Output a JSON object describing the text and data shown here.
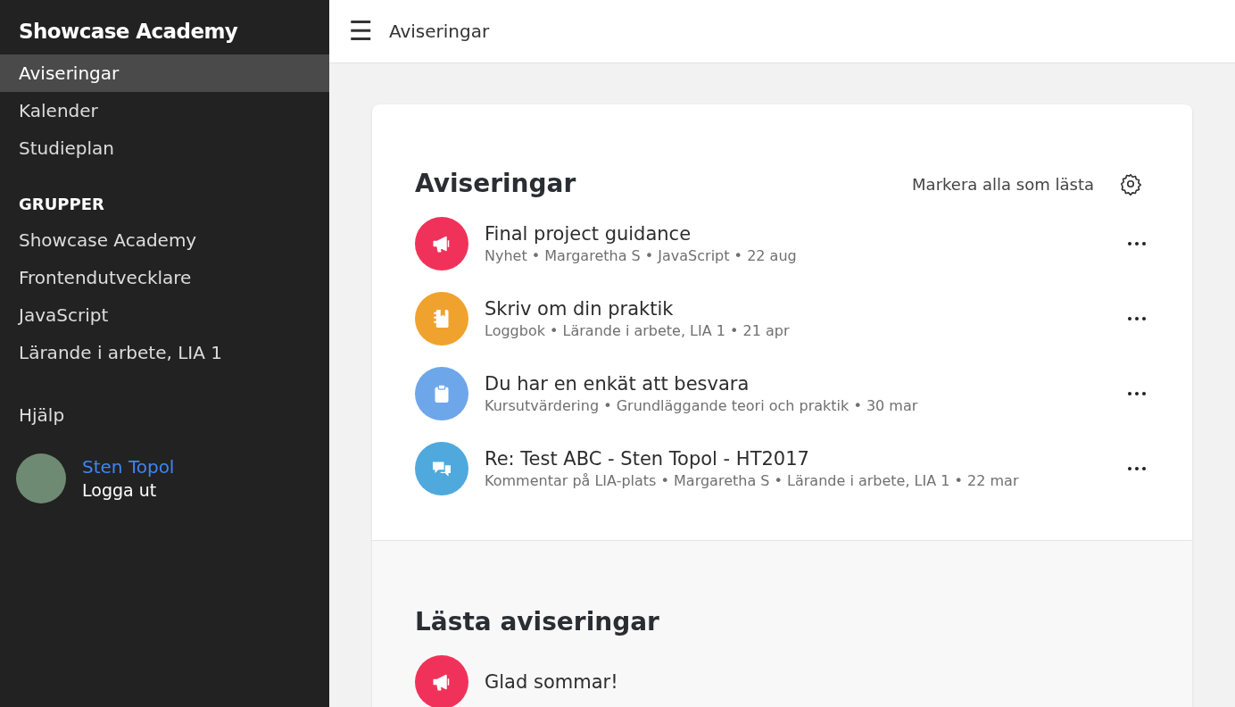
{
  "sidebar": {
    "title": "Showcase Academy",
    "nav": [
      {
        "label": "Aviseringar",
        "selected": true
      },
      {
        "label": "Kalender",
        "selected": false
      },
      {
        "label": "Studieplan",
        "selected": false
      }
    ],
    "groups_heading": "GRUPPER",
    "groups": [
      {
        "label": "Showcase Academy",
        "selected": false
      },
      {
        "label": "Frontendutvecklare",
        "selected": false
      },
      {
        "label": "JavaScript",
        "selected": false
      },
      {
        "label": "Lärande i arbete, LIA 1",
        "selected": false
      }
    ],
    "help": "Hjälp",
    "user": {
      "name": "Sten Topol",
      "logout": "Logga ut"
    }
  },
  "header": {
    "menu_glyph": "☰",
    "title": "Aviseringar"
  },
  "notifications": {
    "title": "Aviseringar",
    "mark_all": "Markera alla som lästa",
    "items": [
      {
        "kind": "news",
        "color": "#f0325a",
        "title": "Final project guidance",
        "meta": "Nyhet • Margaretha S • JavaScript • 22 aug"
      },
      {
        "kind": "logbook",
        "color": "#f0a22e",
        "title": "Skriv om din praktik",
        "meta": "Loggbok • Lärande i arbete, LIA 1 • 21 apr"
      },
      {
        "kind": "survey",
        "color": "#6ea6ea",
        "title": "Du har en enkät att besvara",
        "meta": "Kursutvärdering • Grundläggande teori och praktik • 30 mar"
      },
      {
        "kind": "comment",
        "color": "#4fa9dc",
        "title": "Re: Test ABC - Sten Topol - HT2017",
        "meta": "Kommentar på LIA-plats • Margaretha S • Lärande i arbete, LIA 1 • 22 mar"
      }
    ]
  },
  "read": {
    "title": "Lästa aviseringar",
    "items": [
      {
        "kind": "news",
        "color": "#f0325a",
        "title": "Glad sommar!"
      }
    ]
  }
}
